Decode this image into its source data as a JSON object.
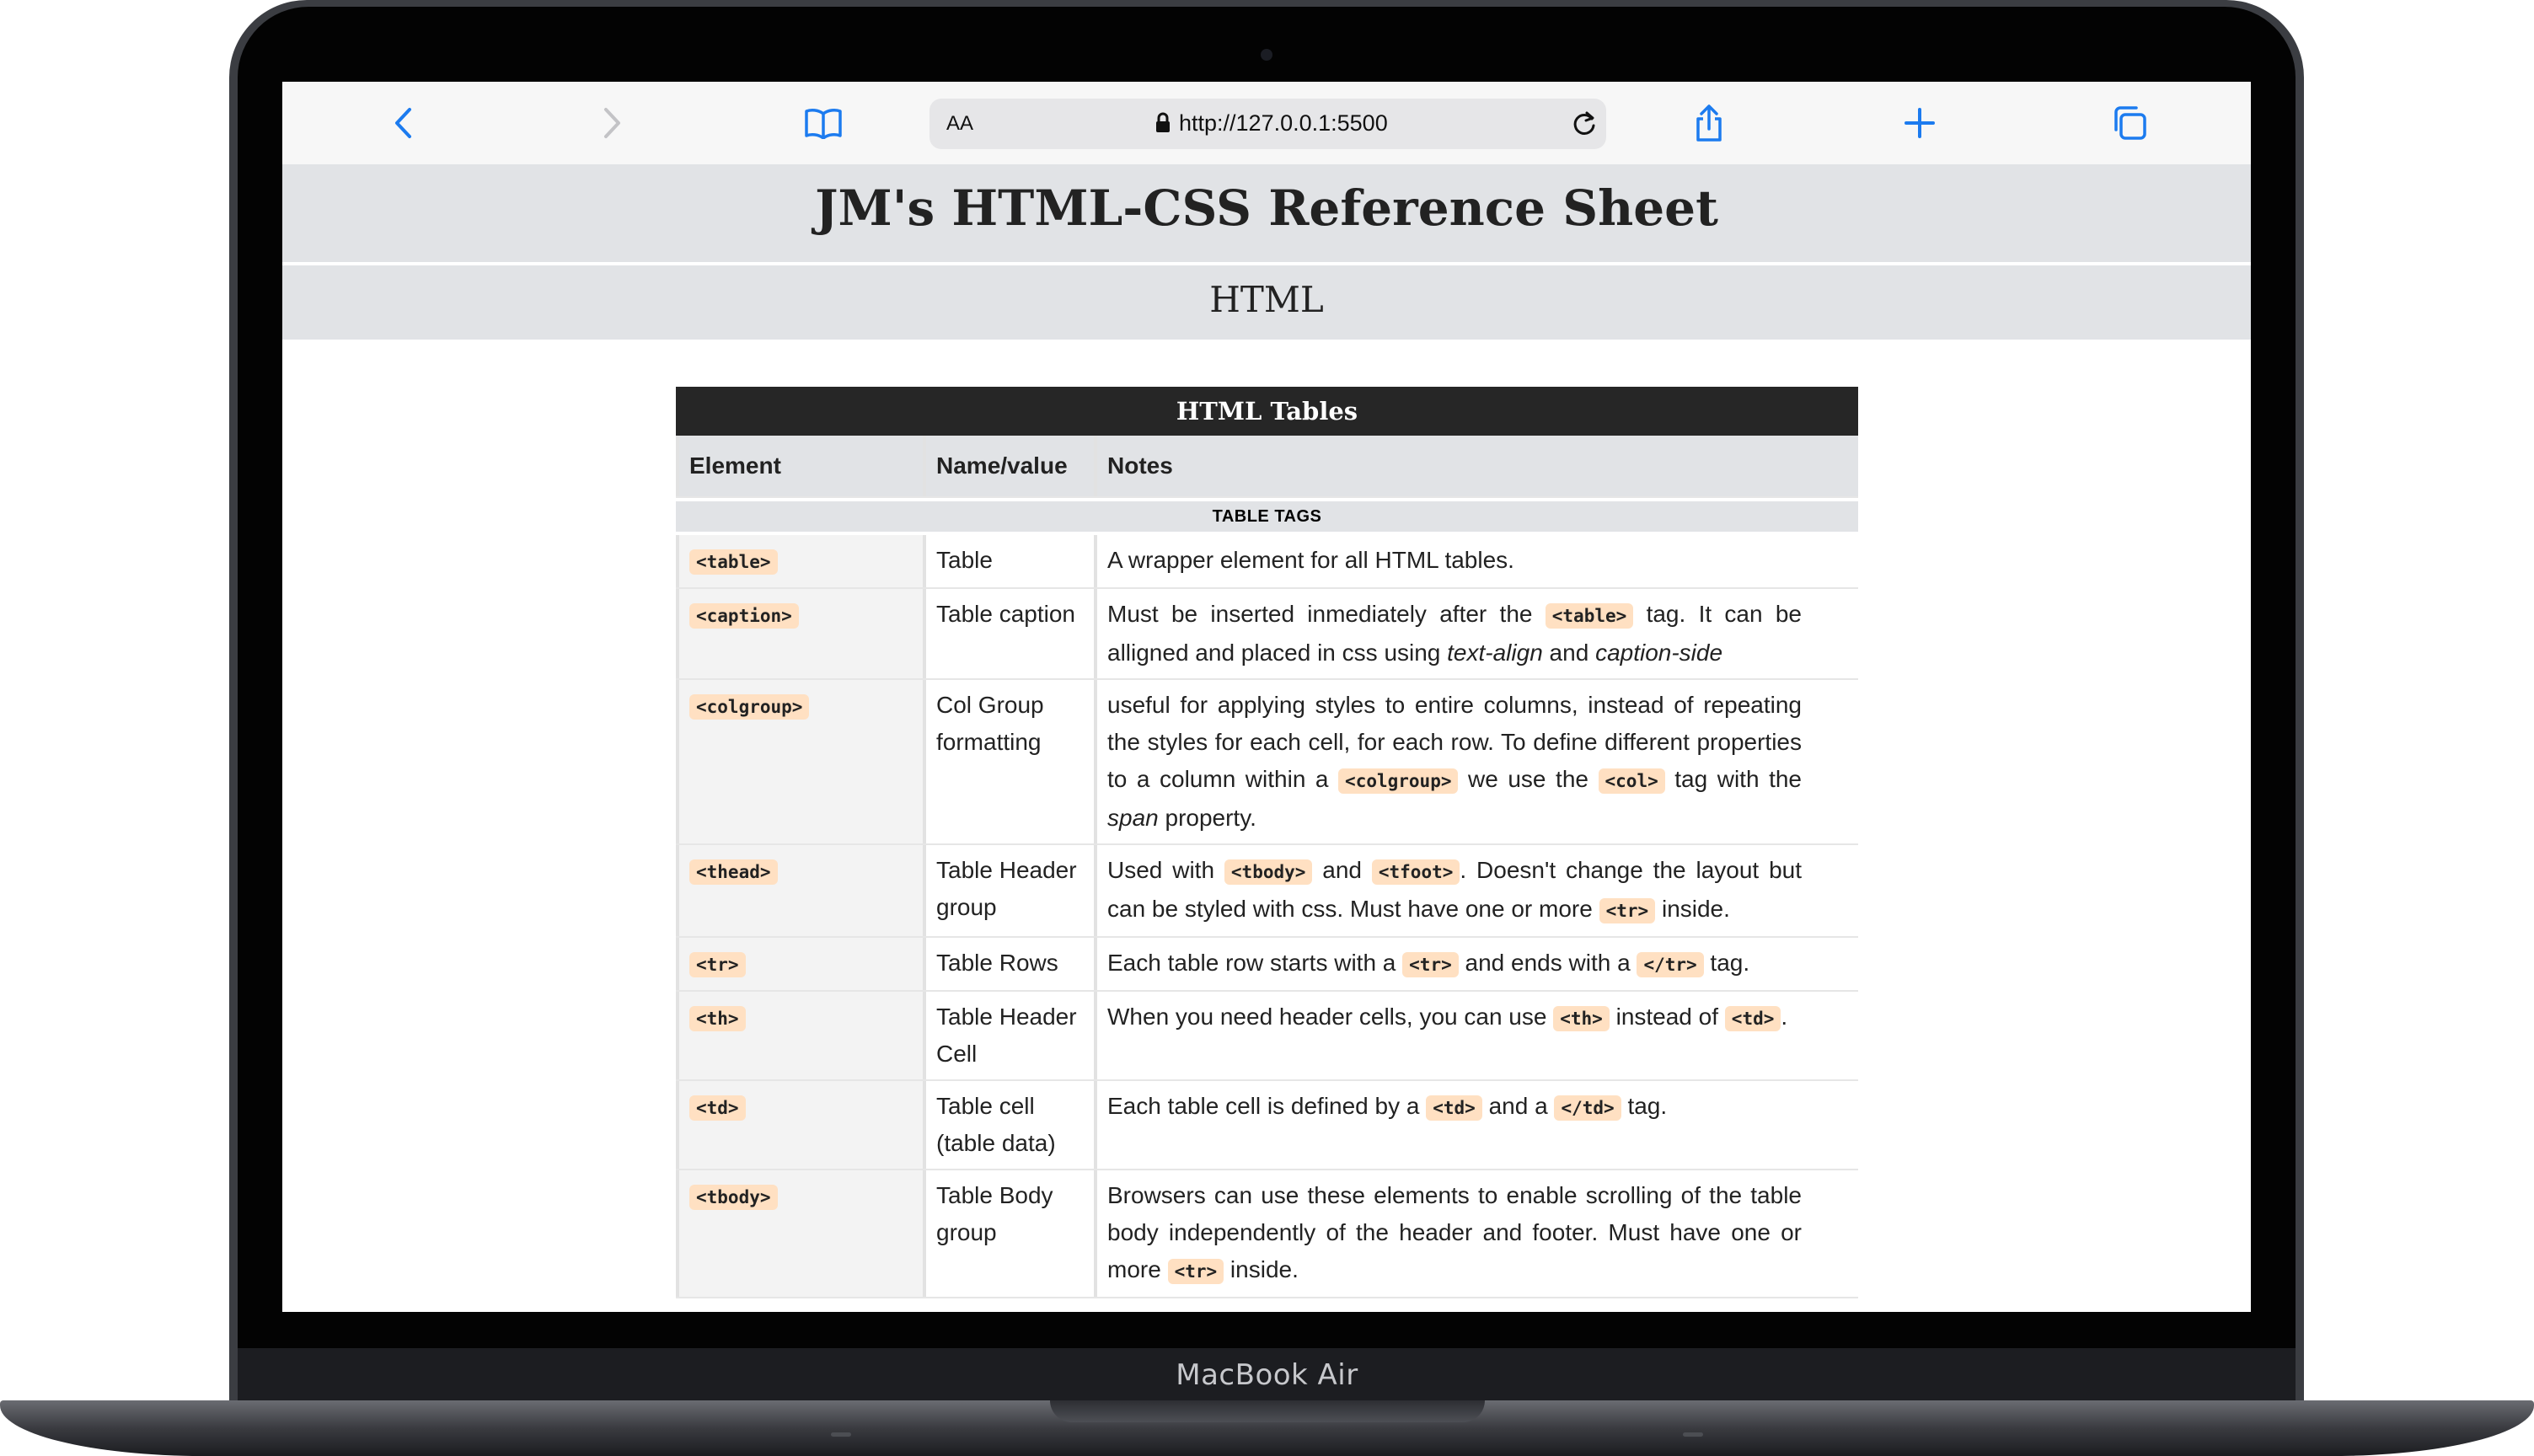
{
  "device": {
    "label": "MacBook Air"
  },
  "browser": {
    "aa_label": "AA",
    "url": "http://127.0.0.1:5500",
    "icons": [
      "back-icon",
      "forward-icon",
      "bookmarks-icon",
      "lock-icon",
      "reload-icon",
      "share-icon",
      "new-tab-icon",
      "tabs-icon"
    ],
    "accent_color": "#1c7bef"
  },
  "page": {
    "title": "JM's HTML-CSS Reference Sheet",
    "section": "HTML"
  },
  "table": {
    "caption": "HTML Tables",
    "columns": [
      "Element",
      "Name/value",
      "Notes"
    ],
    "subheading": "TABLE TAGS",
    "code_highlight_color": "#ffe0c2",
    "rows": [
      {
        "element": "<table>",
        "name": "Table",
        "notes": [
          {
            "t": "A wrapper element for all HTML tables."
          }
        ]
      },
      {
        "element": "<caption>",
        "name": "Table caption",
        "notes": [
          {
            "t": "Must be inserted inmediately after the "
          },
          {
            "code": "<table>"
          },
          {
            "t": " tag. It can be alligned and placed in css using "
          },
          {
            "em": "text-align"
          },
          {
            "t": " and "
          },
          {
            "em": "caption-side"
          }
        ]
      },
      {
        "element": "<colgroup>",
        "name": "Col Group formatting",
        "notes": [
          {
            "t": "useful for applying styles to entire columns, instead of repeating the styles for each cell, for each row. To define different properties to a column within a "
          },
          {
            "code": "<colgroup>"
          },
          {
            "t": " we use the "
          },
          {
            "code": "<col>"
          },
          {
            "t": " tag with the "
          },
          {
            "em": "span"
          },
          {
            "t": " property."
          }
        ]
      },
      {
        "element": "<thead>",
        "name": "Table Header group",
        "notes": [
          {
            "t": "Used with "
          },
          {
            "code": "<tbody>"
          },
          {
            "t": " and "
          },
          {
            "code": "<tfoot>"
          },
          {
            "t": ". Doesn't change the layout but can be styled with css. Must have one or more "
          },
          {
            "code": "<tr>"
          },
          {
            "t": " inside."
          }
        ]
      },
      {
        "element": "<tr>",
        "name": "Table Rows",
        "notes": [
          {
            "t": "Each table row starts with a "
          },
          {
            "code": "<tr>"
          },
          {
            "t": " and ends with a "
          },
          {
            "code": "</tr>"
          },
          {
            "t": " tag."
          }
        ]
      },
      {
        "element": "<th>",
        "name": "Table Header Cell",
        "notes": [
          {
            "t": "When you need header cells, you can use "
          },
          {
            "code": "<th>"
          },
          {
            "t": " instead of "
          },
          {
            "code": "<td>"
          },
          {
            "t": "."
          }
        ]
      },
      {
        "element": "<td>",
        "name": "Table cell (table data)",
        "notes": [
          {
            "t": "Each table cell is defined by a "
          },
          {
            "code": "<td>"
          },
          {
            "t": " and a "
          },
          {
            "code": "</td>"
          },
          {
            "t": " tag."
          }
        ]
      },
      {
        "element": "<tbody>",
        "name": "Table Body group",
        "notes": [
          {
            "t": "Browsers can use these elements to enable scrolling of the table body independently of the header and footer. Must have one or more "
          },
          {
            "code": "<tr>"
          },
          {
            "t": " inside."
          }
        ]
      }
    ]
  }
}
